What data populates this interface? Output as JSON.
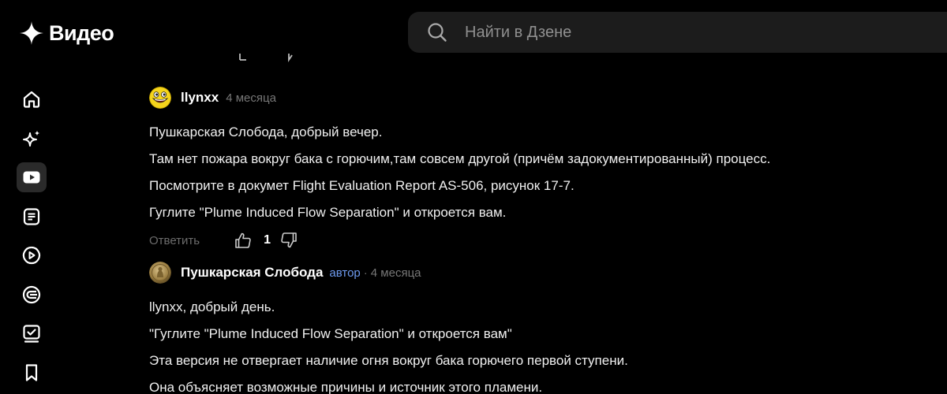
{
  "app": {
    "logo_text": "Видео"
  },
  "search": {
    "placeholder": "Найти в Дзене",
    "value": ""
  },
  "sidebar": {
    "items": [
      {
        "icon": "home-icon",
        "active": false
      },
      {
        "icon": "sparkle-icon",
        "active": false
      },
      {
        "icon": "video-play-icon",
        "active": true
      },
      {
        "icon": "article-icon",
        "active": false
      },
      {
        "icon": "shorts-icon",
        "active": false
      },
      {
        "icon": "channels-icon",
        "active": false
      },
      {
        "icon": "checklist-icon",
        "active": false
      },
      {
        "icon": "bookmark-icon",
        "active": false
      }
    ]
  },
  "comments": [
    {
      "author": "llynxx",
      "badge": "",
      "time": "4 месяца",
      "lines": [
        "Пушкарская Слобода, добрый вечер.",
        "Там нет пожара вокруг бака с горючим,там совсем другой (причём задокументированный) процесс.",
        "Посмотрите в докумет Flight Evaluation Report AS-506, рисунок 17-7.",
        "Гуглите \"Plume Induced Flow Separation\" и откроется вам."
      ],
      "reply_label": "Ответить",
      "likes": "1"
    },
    {
      "author": "Пушкарская Слобода",
      "badge": "автор",
      "separator": "·",
      "time": "4 месяца",
      "lines": [
        "llynxx, добрый день.",
        "\"Гуглите \"Plume Induced Flow Separation\" и откроется вам\"",
        "Эта версия не отвергает наличие огня вокруг бака горючего первой ступени.",
        "Она объясняет возможные причины и источник этого пламени."
      ]
    }
  ],
  "colors": {
    "background": "#000000",
    "search_bg": "#1c1c1c",
    "author_badge": "#6e9bf0",
    "muted": "#777777"
  }
}
